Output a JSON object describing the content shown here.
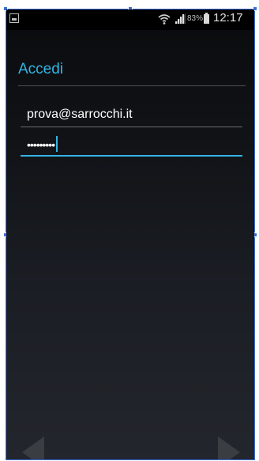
{
  "status_bar": {
    "battery_percent": "83%",
    "time": "12:17",
    "left_icon": "gallery-notification-icon",
    "wifi_icon": "wifi-icon",
    "signal_icon": "signal-icon",
    "battery_icon": "battery-icon"
  },
  "login": {
    "title": "Accedi",
    "email_value": "prova@sarrocchi.it",
    "password_value": "•••••••••"
  },
  "navigation": {
    "prev_icon": "chevron-left-icon",
    "next_icon": "chevron-right-icon"
  },
  "colors": {
    "accent": "#33b5e5",
    "background": "#111317",
    "status_bar": "#000000"
  }
}
